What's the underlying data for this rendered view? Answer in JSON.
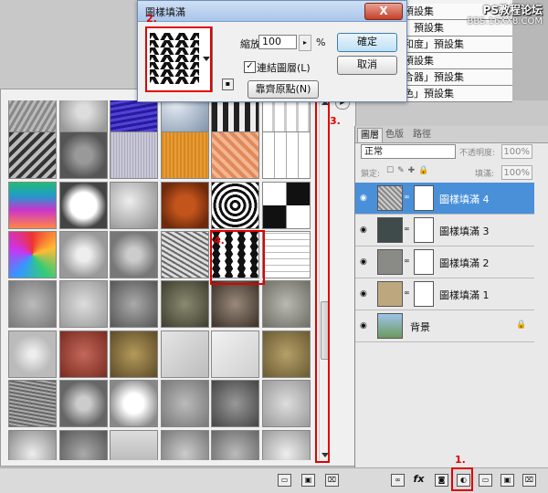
{
  "dialog": {
    "title": "圖樣填滿",
    "close_label": "X",
    "scale_label": "縮放(S):",
    "scale_value": "100",
    "scale_unit": "%",
    "link_checkbox_checked": "✓",
    "link_label": "連結圖層(L)",
    "snap_button": "靠齊原點(N)",
    "ok_button": "確定",
    "cancel_button": "取消"
  },
  "presets": [
    "」預設集",
    "度」預設集",
    "飽和度」預設集",
    "」預設集",
    "混合器」預設集",
    "顏色」預設集"
  ],
  "watermark": {
    "line1": "PS教程论坛",
    "line2": "BBS.16XX8.COM"
  },
  "markers": {
    "m1": "1.",
    "m2": "2.",
    "m3": "3.",
    "m4": "4."
  },
  "layers_panel": {
    "tabs": [
      "圖層",
      "色版",
      "路徑"
    ],
    "blend_mode": "正常",
    "opacity_label": "不透明度:",
    "opacity_value": "100%",
    "lock_label": "鎖定:",
    "fill_label": "填滿:",
    "fill_value": "100%",
    "layers": [
      {
        "name": "圖樣填滿 4",
        "active": true
      },
      {
        "name": "圖樣填滿 3",
        "active": false
      },
      {
        "name": "圖樣填滿 2",
        "active": false
      },
      {
        "name": "圖樣填滿 1",
        "active": false
      },
      {
        "name": "背景",
        "active": false
      }
    ]
  },
  "colors": {
    "accent": "#4a90d9",
    "marker": "#e00000"
  }
}
